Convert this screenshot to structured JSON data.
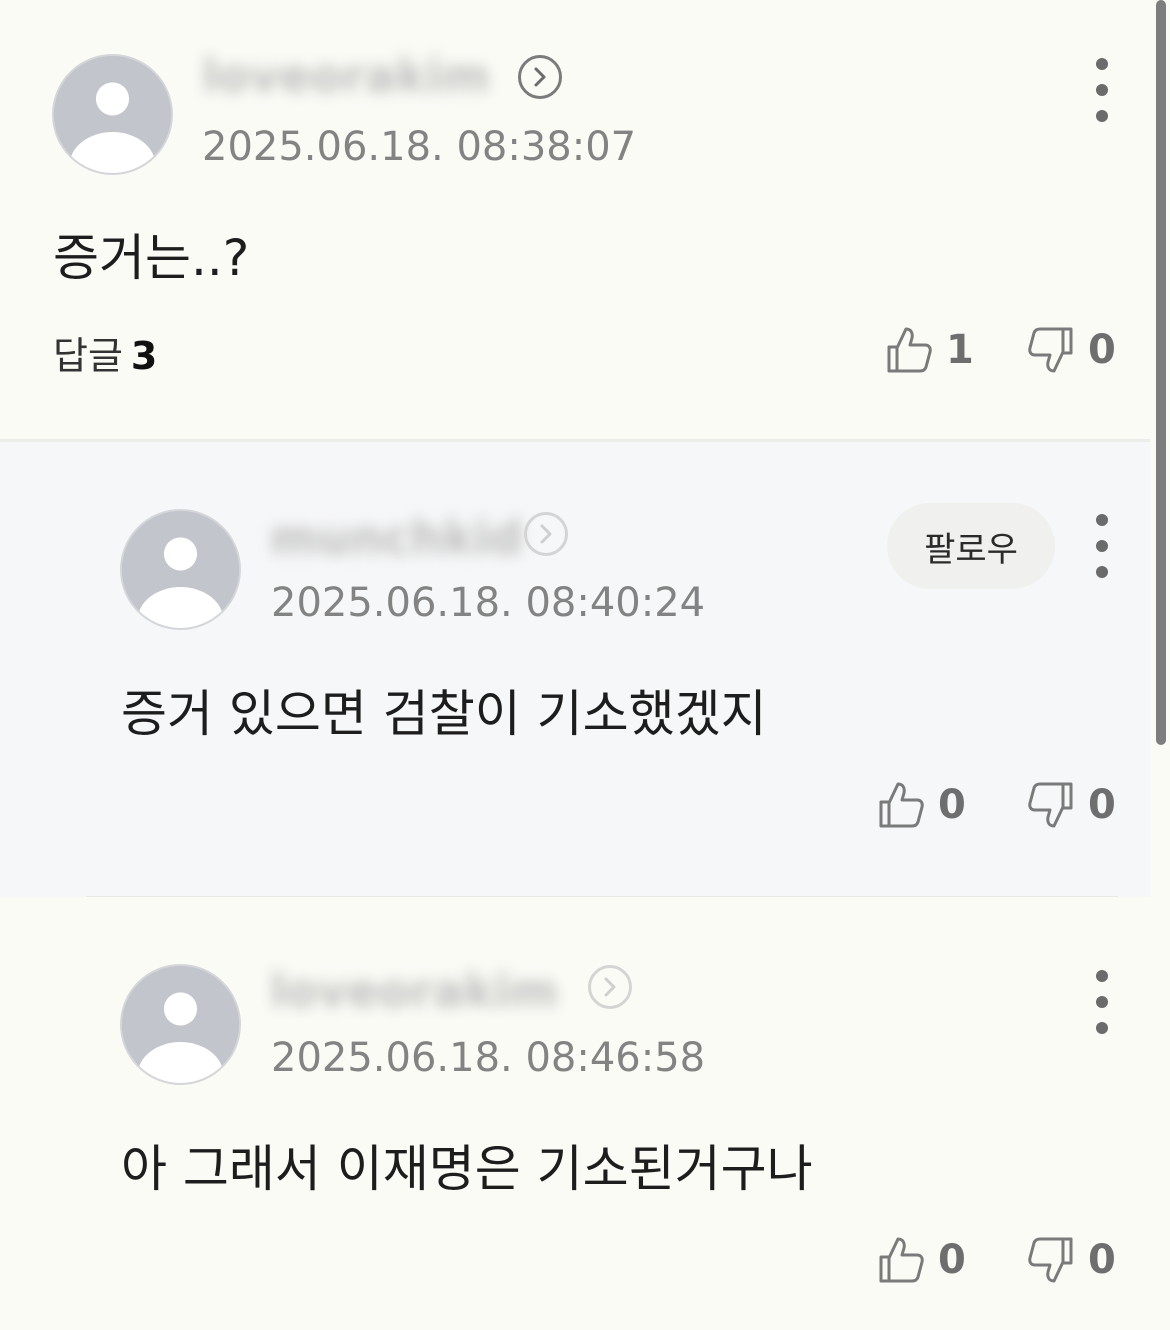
{
  "comments": [
    {
      "username": "loveorakim",
      "timestamp": "2025.06.18. 08:38:07",
      "text": "증거는..?",
      "reply_label": "답글",
      "reply_count": "3",
      "likes": "1",
      "dislikes": "0"
    },
    {
      "username": "munchkid",
      "timestamp": "2025.06.18. 08:40:24",
      "text": "증거 있으면 검찰이 기소했겠지",
      "follow_label": "팔로우",
      "likes": "0",
      "dislikes": "0"
    },
    {
      "username": "loveorakim",
      "timestamp": "2025.06.18. 08:46:58",
      "text": "아 그래서 이재명은 기소된거구나",
      "likes": "0",
      "dislikes": "0"
    }
  ],
  "icons": {
    "avatar": "default-user-avatar-icon",
    "profile_link": "chevron-right-icon",
    "more": "vertical-ellipsis-icon",
    "like": "thumbs-up-icon",
    "dislike": "thumbs-down-icon"
  },
  "colors": {
    "background": "#fbfbf6",
    "reply_background": "#f6f7f8",
    "timestamp": "#838383",
    "avatar": "#c2c5cb"
  }
}
